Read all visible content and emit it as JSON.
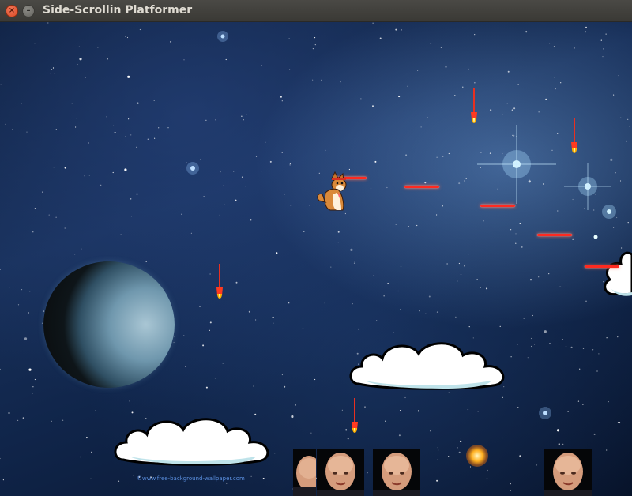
{
  "window": {
    "title": "Side-Scrollin Platformer",
    "close_glyph": "×",
    "minimize_glyph": "–"
  },
  "game": {
    "player": "shiba-dog-sprite",
    "enemies": "bezos-face-sprite",
    "watermark": "©www.free-background-wallpaper.com"
  },
  "colors": {
    "laser": "#ff2a20",
    "cloud_fill": "#ffffff",
    "cloud_shadow": "#bfe3ea",
    "cloud_outline": "#000000",
    "rocket_flame": "#ffb000"
  }
}
